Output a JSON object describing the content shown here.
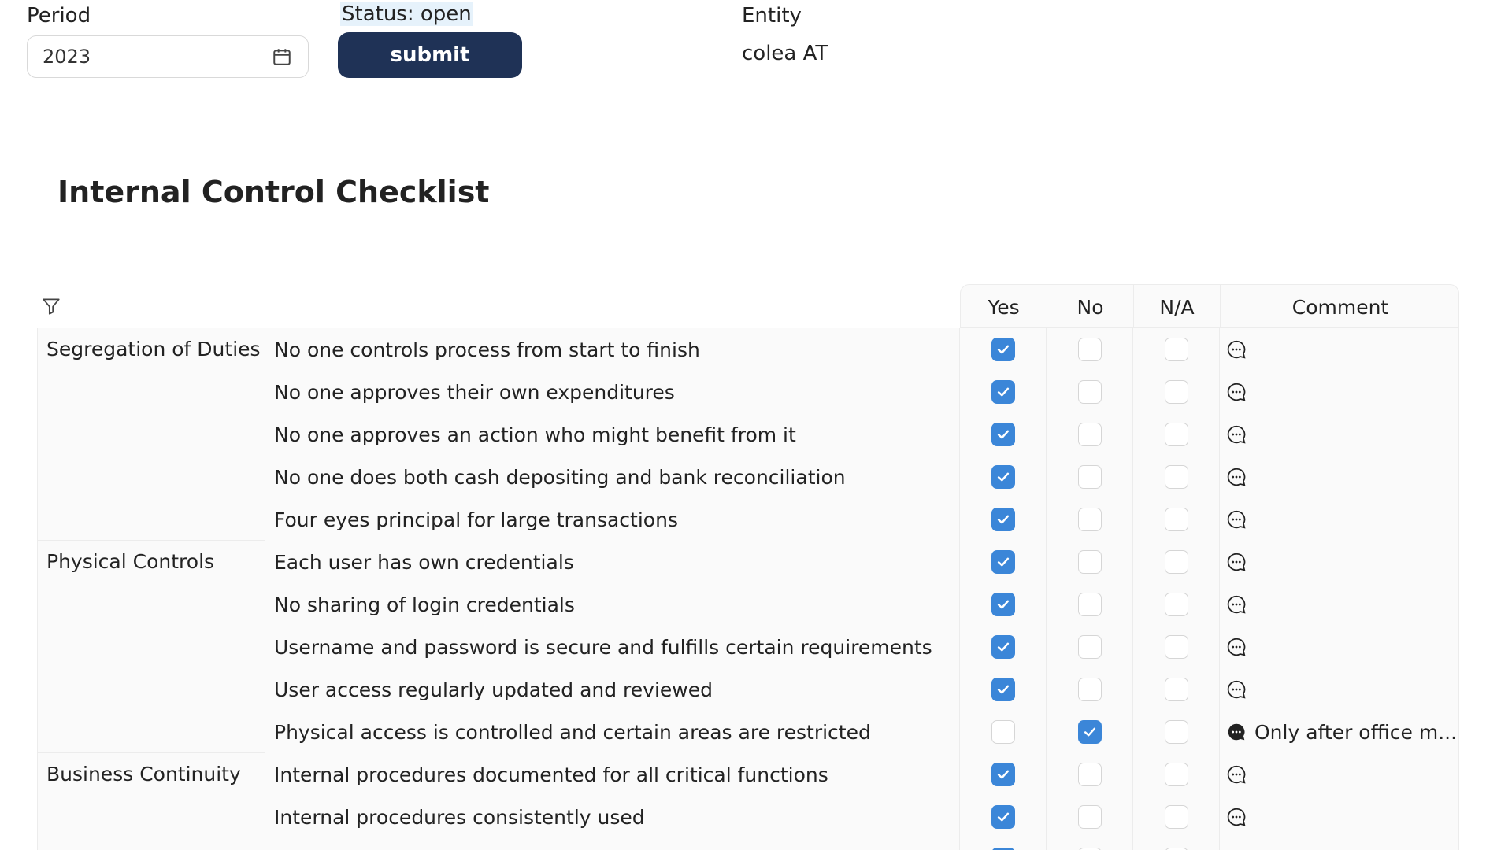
{
  "header": {
    "period_label": "Period",
    "period_value": "2023",
    "status_label": "Status: open",
    "submit_label": "submit",
    "entity_label": "Entity",
    "entity_value": "colea AT"
  },
  "page_title": "Internal Control Checklist",
  "table": {
    "columns": [
      "Yes",
      "No",
      "N/A",
      "Comment"
    ],
    "groups": [
      {
        "label": "Segregation of Duties"
      },
      {
        "label": "Physical Controls"
      },
      {
        "label": "Business Continuity"
      }
    ],
    "rows": [
      {
        "group": 0,
        "question": "No one controls process from start to finish",
        "answer": "yes",
        "comment": ""
      },
      {
        "group": 0,
        "question": "No one approves their own expenditures",
        "answer": "yes",
        "comment": ""
      },
      {
        "group": 0,
        "question": "No one approves an action who might benefit from it",
        "answer": "yes",
        "comment": ""
      },
      {
        "group": 0,
        "question": "No one does both cash depositing and bank reconciliation",
        "answer": "yes",
        "comment": ""
      },
      {
        "group": 0,
        "question": "Four eyes principal for large transactions",
        "answer": "yes",
        "comment": ""
      },
      {
        "group": 1,
        "question": "Each user has own credentials",
        "answer": "yes",
        "comment": ""
      },
      {
        "group": 1,
        "question": "No sharing of login credentials",
        "answer": "yes",
        "comment": ""
      },
      {
        "group": 1,
        "question": "Username and password is secure and fulfills certain requirements",
        "answer": "yes",
        "comment": ""
      },
      {
        "group": 1,
        "question": "User access regularly updated and reviewed",
        "answer": "yes",
        "comment": ""
      },
      {
        "group": 1,
        "question": "Physical access is controlled and certain areas are restricted",
        "answer": "no",
        "comment": "Only after office m..."
      },
      {
        "group": 2,
        "question": "Internal procedures documented for all critical functions",
        "answer": "yes",
        "comment": ""
      },
      {
        "group": 2,
        "question": "Internal procedures consistently used",
        "answer": "yes",
        "comment": ""
      },
      {
        "group": 2,
        "question": "",
        "answer": "yes",
        "comment": ""
      }
    ]
  },
  "colors": {
    "accent": "#3b86d8",
    "button": "#1f3256",
    "status_bg": "#e6f2fb"
  },
  "icons": {
    "calendar": "calendar-icon",
    "filter": "filter-icon",
    "comment": "comment-icon",
    "check": "check-icon"
  }
}
